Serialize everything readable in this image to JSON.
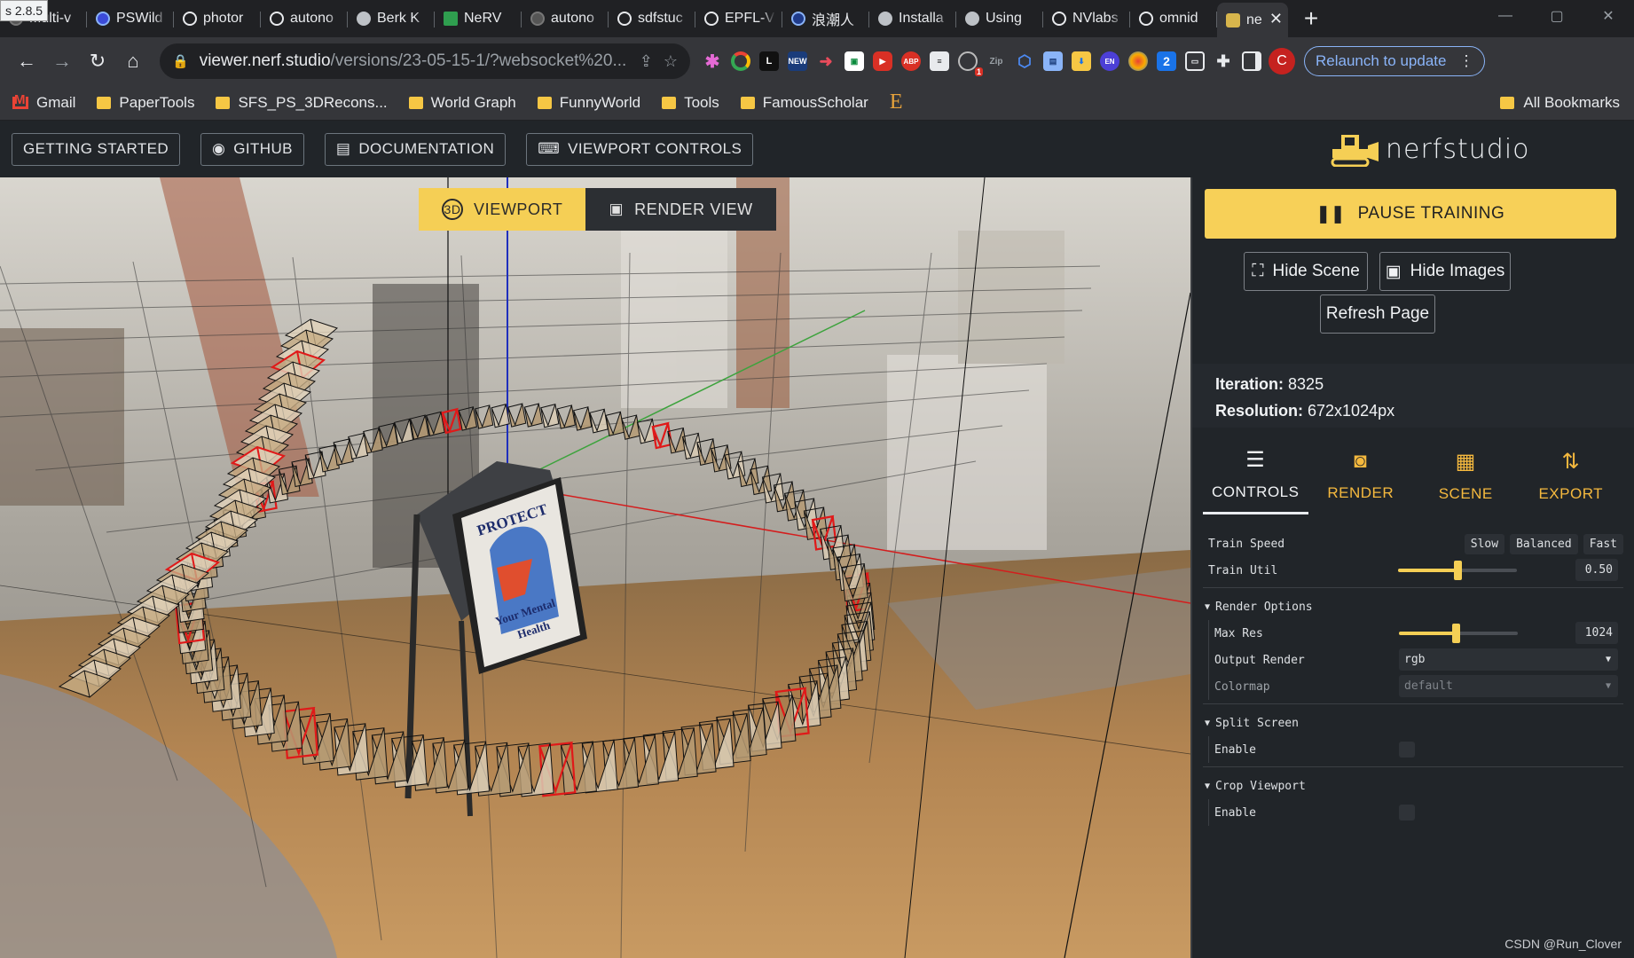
{
  "browser": {
    "tooltip": "s 2.8.5",
    "tabs": [
      {
        "label": "Multi-v",
        "icon": "dim"
      },
      {
        "label": "PSWild",
        "icon": "blue"
      },
      {
        "label": "photor",
        "icon": "gh"
      },
      {
        "label": "autono",
        "icon": "gh"
      },
      {
        "label": "Berk K",
        "icon": "globe"
      },
      {
        "label": "NeRV",
        "icon": "nerv"
      },
      {
        "label": "autono",
        "icon": "dim"
      },
      {
        "label": "sdfstuc",
        "icon": "gh"
      },
      {
        "label": "EPFL-V",
        "icon": "gh"
      },
      {
        "label": "浪潮人",
        "icon": "wang"
      },
      {
        "label": "Installa",
        "icon": "globe"
      },
      {
        "label": "Using",
        "icon": "globe"
      },
      {
        "label": "NVlabs",
        "icon": "gh"
      },
      {
        "label": "omnid",
        "icon": "gh"
      },
      {
        "label": "ne",
        "icon": "ns",
        "active": true
      }
    ],
    "url_host": "viewer.nerf.studio",
    "url_path": "/versions/23-05-15-1/?websocket%20...",
    "relaunch_label": "Relaunch to update",
    "avatar_letter": "C",
    "bookmarks": [
      "Gmail",
      "PaperTools",
      "SFS_PS_3DRecons...",
      "World Graph",
      "FunnyWorld",
      "Tools",
      "FamousScholar"
    ],
    "all_bookmarks": "All Bookmarks"
  },
  "header": {
    "getting_started": "GETTING STARTED",
    "github": "GITHUB",
    "documentation": "DOCUMENTATION",
    "viewport_controls": "VIEWPORT CONTROLS",
    "logo_text": "nerfstudio"
  },
  "viewport": {
    "tab_viewport": "VIEWPORT",
    "tab_render_view": "RENDER VIEW",
    "poster_line1": "PROTECT",
    "poster_line2": "Your Mental",
    "poster_line3": "Health"
  },
  "panel": {
    "pause_training": "PAUSE TRAINING",
    "hide_scene": "Hide Scene",
    "hide_images": "Hide Images",
    "refresh_page": "Refresh Page",
    "iteration_label": "Iteration:",
    "iteration_value": "8325",
    "resolution_label": "Resolution:",
    "resolution_value": "672x1024px",
    "tabs": [
      "CONTROLS",
      "RENDER",
      "SCENE",
      "EXPORT"
    ],
    "controls": {
      "train_speed_label": "Train Speed",
      "speed_options": [
        "Slow",
        "Balanced",
        "Fast"
      ],
      "train_util_label": "Train Util",
      "train_util_value": "0.50",
      "train_util_fraction": 0.5,
      "render_options_label": "Render Options",
      "max_res_label": "Max Res",
      "max_res_value": "1024",
      "max_res_fraction": 0.48,
      "output_render_label": "Output Render",
      "output_render_value": "rgb",
      "colormap_label": "Colormap",
      "colormap_value": "default",
      "split_screen_label": "Split Screen",
      "split_enable_label": "Enable",
      "crop_viewport_label": "Crop Viewport",
      "crop_enable_label": "Enable"
    }
  },
  "watermark": "CSDN @Run_Clover"
}
